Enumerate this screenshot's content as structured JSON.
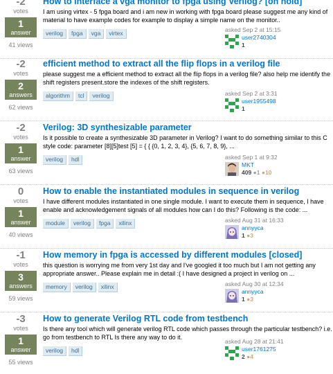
{
  "questions": [
    {
      "votes": "-2",
      "votes_label": "votes",
      "answers": "1",
      "answers_label": "answer",
      "views": "41 views",
      "title": "How to interface a vga monitor to fpga using Verilog? [on hold]",
      "excerpt": "I am using virtex - 5 fpga board and i am new in working with fpga board please suggest me any kind of material to have example codes for example to display a simple name on the monitor..",
      "tags": [
        "verilog",
        "fpga",
        "vga",
        "virtex"
      ],
      "asked": "asked Sep 2 at 15:15",
      "user": "user2740304",
      "rep": "1",
      "silver": "",
      "bronze": "",
      "avatar": "identicon-green"
    },
    {
      "votes": "-2",
      "votes_label": "votes",
      "answers": "2",
      "answers_label": "answers",
      "views": "62 views",
      "title": "efficient method to extract all the flip flops in a verilog file",
      "excerpt": "please suggest me a efficient method to extract all the flip flops in a verilog file? also help me identify the shift registers present.store the indexes of the shift registers.",
      "tags": [
        "algorithm",
        "tcl",
        "verilog"
      ],
      "asked": "asked Sep 2 at 3:31",
      "user": "user1955498",
      "rep": "1",
      "silver": "",
      "bronze": "",
      "avatar": "identicon-green"
    },
    {
      "votes": "-2",
      "votes_label": "votes",
      "answers": "1",
      "answers_label": "answer",
      "views": "63 views",
      "title": "Verilog: 3D synthesizable parameter",
      "excerpt": "Is it possible to create a synthesizable 3D parameter in Verilog? I want to do something similar to this C style code: parameter [8][5]test [5] = { { {0, 1, 2, 3, 4}, {5, 6, 7, 8, 9}, ...",
      "tags": [
        "verilog",
        "hdl"
      ],
      "asked": "asked Sep 1 at 9:32",
      "user": "MKT",
      "rep": "409",
      "silver": "●1",
      "bronze": "●10",
      "avatar": "photo"
    },
    {
      "votes": "0",
      "votes_label": "votes",
      "answers": "1",
      "answers_label": "answer",
      "views": "40 views",
      "title": "How to enable the instantiated modules in sequence in verilog",
      "excerpt": "I have different modules instantiated in one single module. I want to execute them in sequence, I have enable and acknowledgement signals of all modules how can I do this? Following is the code: ...",
      "tags": [
        "module",
        "verilog",
        "fpga",
        "xilinx"
      ],
      "asked": "asked Aug 31 at 16:33",
      "user": "annyyca",
      "rep": "1",
      "silver": "",
      "bronze": "●3",
      "avatar": "anime"
    },
    {
      "votes": "-1",
      "votes_label": "votes",
      "answers": "3",
      "answers_label": "answers",
      "views": "59 views",
      "title": "How memory in fpga is accessed by different modules [closed]",
      "excerpt": "this question is worrying me from very 1st day and I've googled it too much but I am not getting any appropriate answer.. Please explain me in detail :( I have designed a project in verilog on ...",
      "tags": [
        "memory",
        "verilog",
        "xilinx"
      ],
      "asked": "asked Aug 30 at 12:34",
      "user": "annyyca",
      "rep": "1",
      "silver": "",
      "bronze": "●3",
      "avatar": "anime"
    },
    {
      "votes": "-3",
      "votes_label": "votes",
      "answers": "1",
      "answers_label": "answer",
      "views": "55 views",
      "title": "How to generate Verilog RTL code from testbench",
      "excerpt": "Is there any tool which will generate verilog RTL code which passes through the particular testbench? i.e. go from testbench to RTL Is there any way to do it.",
      "tags": [
        "verilog",
        "hdl"
      ],
      "asked": "asked Aug 28 at 21:41",
      "user": "user1761275",
      "rep": "2",
      "silver": "",
      "bronze": "●4",
      "avatar": "identicon-green"
    }
  ]
}
